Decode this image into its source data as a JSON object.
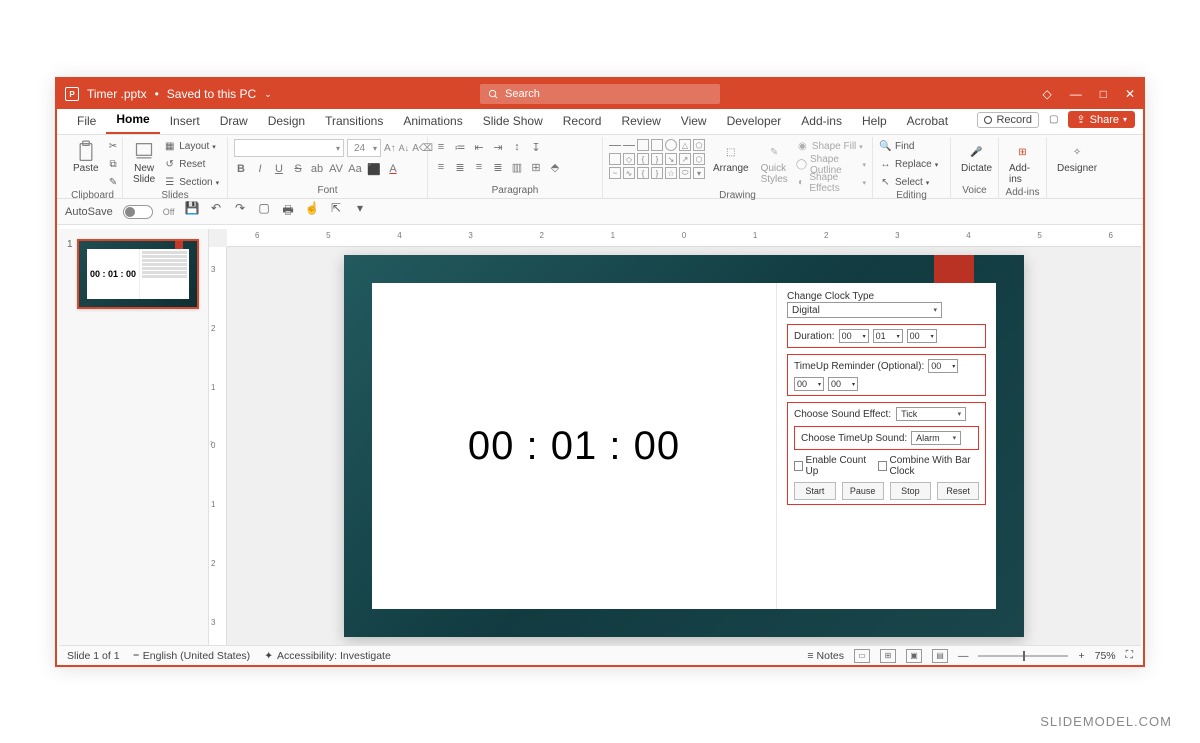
{
  "titlebar": {
    "filename": "Timer .pptx",
    "saved_status": "Saved to this PC",
    "separator": " • ",
    "search_placeholder": "Search"
  },
  "tabs": {
    "items": [
      "File",
      "Home",
      "Insert",
      "Draw",
      "Design",
      "Transitions",
      "Animations",
      "Slide Show",
      "Record",
      "Review",
      "View",
      "Developer",
      "Add-ins",
      "Help",
      "Acrobat"
    ],
    "active_index": 1,
    "record_btn": "Record",
    "share_btn": "Share"
  },
  "ribbon": {
    "clipboard": {
      "label": "Clipboard",
      "paste": "Paste"
    },
    "slides": {
      "label": "Slides",
      "new_slide": "New\nSlide",
      "layout": "Layout",
      "reset": "Reset",
      "section": "Section"
    },
    "font": {
      "label": "Font",
      "size_placeholder": "24"
    },
    "paragraph": {
      "label": "Paragraph"
    },
    "drawing": {
      "label": "Drawing",
      "arrange": "Arrange",
      "quick_styles": "Quick\nStyles",
      "shape_fill": "Shape Fill",
      "shape_outline": "Shape Outline",
      "shape_effects": "Shape Effects"
    },
    "editing": {
      "label": "Editing",
      "find": "Find",
      "replace": "Replace",
      "select": "Select"
    },
    "voice": {
      "label": "Voice",
      "dictate": "Dictate"
    },
    "addins": {
      "label": "Add-ins",
      "btn": "Add-ins"
    },
    "designer": {
      "label": "",
      "btn": "Designer"
    }
  },
  "qat": {
    "autosave": "AutoSave",
    "off": "Off"
  },
  "thumbnail": {
    "number": "1",
    "time": "00 : 01 : 00"
  },
  "ruler": {
    "h": [
      "6",
      "5",
      "4",
      "3",
      "2",
      "1",
      "0",
      "1",
      "2",
      "3",
      "4",
      "5",
      "6"
    ],
    "v": [
      "3",
      "2",
      "1",
      "0",
      "1",
      "2",
      "3"
    ]
  },
  "slide": {
    "time_display": "00 : 01 : 00",
    "change_clock_label": "Change Clock Type",
    "clock_type_value": "Digital",
    "duration_label": "Duration:",
    "duration": {
      "hh": "00",
      "mm": "01",
      "ss": "00"
    },
    "timeup_label": "TimeUp Reminder (Optional):",
    "timeup": {
      "hh": "00",
      "mm": "00",
      "ss": "00"
    },
    "sound_label": "Choose Sound Effect:",
    "sound_value": "Tick",
    "timeup_sound_label": "Choose TimeUp Sound:",
    "timeup_sound_value": "Alarm",
    "cb_countup": "Enable Count Up",
    "cb_barclock": "Combine With Bar Clock",
    "buttons": {
      "start": "Start",
      "pause": "Pause",
      "stop": "Stop",
      "reset": "Reset"
    }
  },
  "statusbar": {
    "slide_count": "Slide 1 of 1",
    "language": "English (United States)",
    "accessibility": "Accessibility: Investigate",
    "notes": "Notes",
    "zoom": "75%"
  },
  "watermark": "SLIDEMODEL.COM"
}
